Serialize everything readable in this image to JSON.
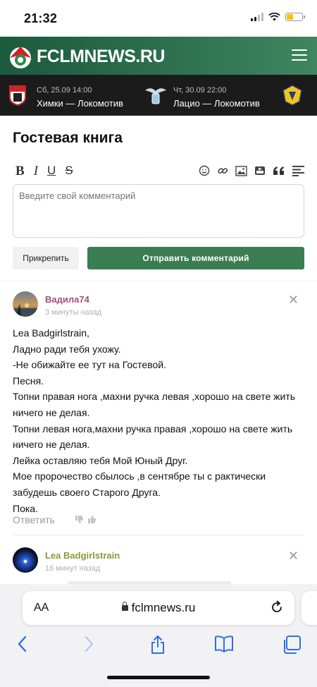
{
  "status_bar": {
    "time": "21:32"
  },
  "site": {
    "name": "FCLMNEWS.RU"
  },
  "matches": [
    {
      "date": "Сб, 25.09 14:00",
      "teams": "Химки — Локомотив"
    },
    {
      "date": "Чт, 30.09 22:00",
      "teams": "Лацио — Локомотив"
    }
  ],
  "guestbook": {
    "title": "Гостевая книга",
    "toolbar": {
      "bold": "B",
      "italic": "I",
      "underline": "U",
      "strike": "S"
    },
    "comment_placeholder": "Введите свой комментарий",
    "attach_label": "Прикрепить",
    "send_label": "Отправить комментарий"
  },
  "posts": [
    {
      "author": "Вадила74",
      "author_color": "#a3507a",
      "time_ago": "3 минуты назад",
      "body": [
        "Lea Badgirlstrain,",
        "Ладно ради тебя ухожу.",
        "-Не обижайте ее тут на Гостевой.",
        "Песня.",
        "Топни правая нога ,махни ручка левая ,хорошо на свете жить ничего не делая.",
        "Топни левая нога,махни ручка правая ,хорошо на свете жить ничего не делая.",
        "Лейка оставляю тебя Мой Юный Друг.",
        "Мое пророчество сбылось ,в сентябре ты с рактически забудешь своего Старого Друга.",
        "Пока."
      ],
      "reply_label": "Ответить"
    },
    {
      "author": "Lea Badgirlstrain",
      "author_color": "#8a9a3c",
      "time_ago": "16 минут назад"
    }
  ],
  "browser": {
    "text_size_label": "AA",
    "url": "fclmnews.ru"
  }
}
